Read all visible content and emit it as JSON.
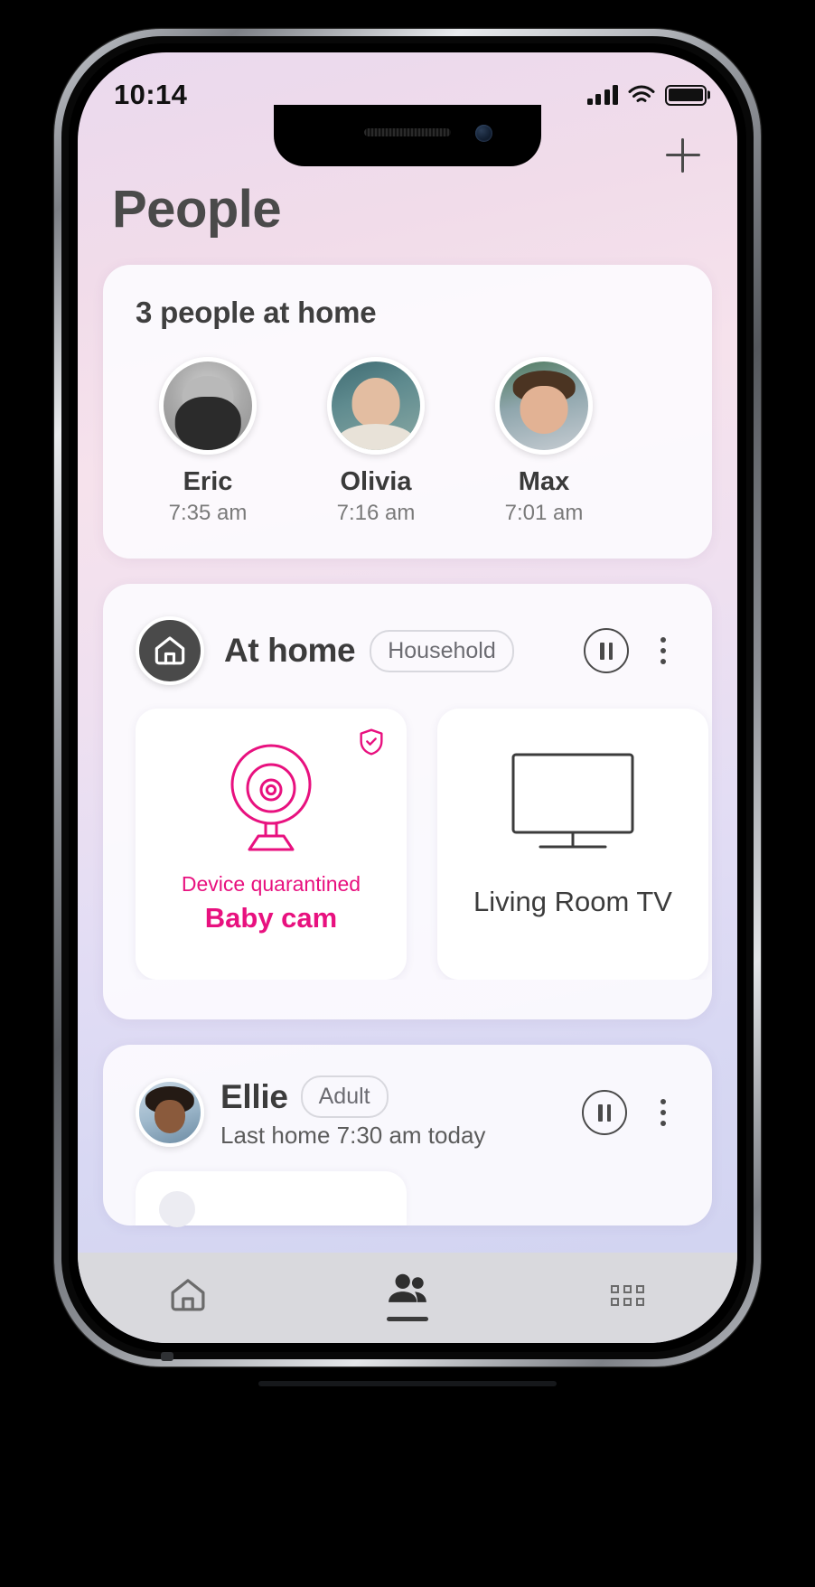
{
  "status_bar": {
    "time": "10:14",
    "signal_icon": "cellular-signal-icon",
    "wifi_icon": "wifi-icon",
    "battery_icon": "battery-full-icon"
  },
  "header": {
    "title": "People",
    "add_icon": "plus-icon"
  },
  "people_card": {
    "heading": "3 people at home",
    "people": [
      {
        "name": "Eric",
        "time": "7:35 am",
        "avatar_icon": "avatar-eric"
      },
      {
        "name": "Olivia",
        "time": "7:16 am",
        "avatar_icon": "avatar-olivia"
      },
      {
        "name": "Max",
        "time": "7:01 am",
        "avatar_icon": "avatar-max"
      }
    ]
  },
  "at_home_section": {
    "home_icon": "home-icon",
    "title": "At home",
    "badge": "Household",
    "pause_icon": "pause-circle-icon",
    "more_icon": "more-vertical-icon",
    "devices": [
      {
        "status": "Device quarantined",
        "name": "Baby cam",
        "device_icon": "security-camera-icon",
        "badge_icon": "shield-check-icon",
        "accent": "#e8117f",
        "quarantined": true
      },
      {
        "status": "",
        "name": "Living Room TV",
        "device_icon": "television-icon",
        "badge_icon": "",
        "accent": "#3c3c3c",
        "quarantined": false
      }
    ]
  },
  "profile_card": {
    "avatar_icon": "avatar-ellie",
    "name": "Ellie",
    "badge": "Adult",
    "subtitle": "Last home 7:30 am today",
    "pause_icon": "pause-circle-icon",
    "more_icon": "more-vertical-icon"
  },
  "tab_bar": {
    "tabs": [
      {
        "icon": "home-outline-icon",
        "active": false
      },
      {
        "icon": "people-filled-icon",
        "active": true
      },
      {
        "icon": "apps-grid-icon",
        "active": false
      }
    ]
  },
  "colors": {
    "accent_pink": "#e8117f",
    "text_dark": "#3c3c3c",
    "text_muted": "#7a7a7a",
    "tabbar_bg": "#d9d9dd"
  }
}
